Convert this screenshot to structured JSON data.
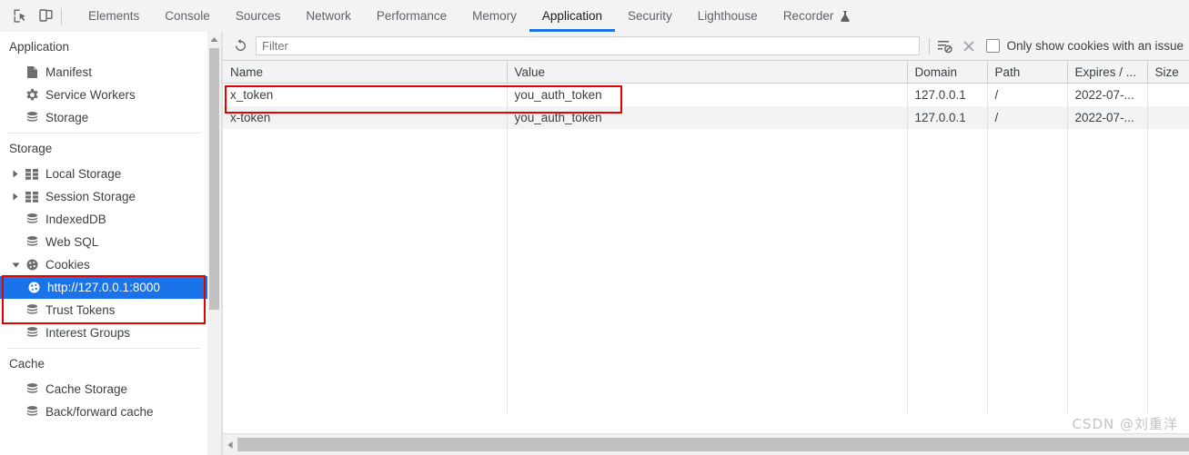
{
  "toolbar": {
    "inspect_icon": "inspect-element-icon",
    "device_icon": "device-toolbar-icon",
    "tabs": [
      {
        "label": "Elements",
        "active": false
      },
      {
        "label": "Console",
        "active": false
      },
      {
        "label": "Sources",
        "active": false
      },
      {
        "label": "Network",
        "active": false
      },
      {
        "label": "Performance",
        "active": false
      },
      {
        "label": "Memory",
        "active": false
      },
      {
        "label": "Application",
        "active": true
      },
      {
        "label": "Security",
        "active": false
      },
      {
        "label": "Lighthouse",
        "active": false
      },
      {
        "label": "Recorder",
        "active": false,
        "icon": "flask-experiment-icon"
      }
    ],
    "active_tab": "Application",
    "accent_color": "#1a73e8"
  },
  "sidebar": {
    "sections": [
      {
        "title": "Application",
        "items": [
          {
            "label": "Manifest",
            "icon": "document-icon",
            "expandable": false,
            "selected": false
          },
          {
            "label": "Service Workers",
            "icon": "gear-icon",
            "expandable": false,
            "selected": false
          },
          {
            "label": "Storage",
            "icon": "database-icon",
            "expandable": false,
            "selected": false
          }
        ]
      },
      {
        "title": "Storage",
        "items": [
          {
            "label": "Local Storage",
            "icon": "table-grid-icon",
            "expandable": true,
            "expanded": false,
            "selected": false
          },
          {
            "label": "Session Storage",
            "icon": "table-grid-icon",
            "expandable": true,
            "expanded": false,
            "selected": false
          },
          {
            "label": "IndexedDB",
            "icon": "database-icon",
            "expandable": false,
            "selected": false
          },
          {
            "label": "Web SQL",
            "icon": "database-icon",
            "expandable": false,
            "selected": false
          },
          {
            "label": "Cookies",
            "icon": "cookie-icon",
            "expandable": true,
            "expanded": true,
            "selected": false
          },
          {
            "label": "http://127.0.0.1:8000",
            "icon": "cookie-icon",
            "expandable": false,
            "selected": true,
            "child": true
          },
          {
            "label": "Trust Tokens",
            "icon": "database-icon",
            "expandable": false,
            "selected": false
          },
          {
            "label": "Interest Groups",
            "icon": "database-icon",
            "expandable": false,
            "selected": false
          }
        ]
      },
      {
        "title": "Cache",
        "items": [
          {
            "label": "Cache Storage",
            "icon": "database-icon",
            "expandable": false,
            "selected": false
          },
          {
            "label": "Back/forward cache",
            "icon": "database-icon",
            "expandable": false,
            "selected": false
          }
        ]
      }
    ]
  },
  "panel": {
    "refresh_icon": "refresh-icon",
    "clear_all_icon": "clear-all-cookies-icon",
    "delete_icon": "delete-selected-icon",
    "filter_placeholder": "Filter",
    "filter_value": "",
    "issue_checkbox_label": "Only show cookies with an issue",
    "issue_checkbox_checked": false
  },
  "table": {
    "columns": [
      "Name",
      "Value",
      "Domain",
      "Path",
      "Expires / ...",
      "Size"
    ],
    "rows": [
      {
        "name": "x_token",
        "value": "you_auth_token",
        "domain": "127.0.0.1",
        "path": "/",
        "expires": "2022-07-...",
        "size": "",
        "highlighted": true
      },
      {
        "name": "x-token",
        "value": "you_auth_token",
        "domain": "127.0.0.1",
        "path": "/",
        "expires": "2022-07-...",
        "size": "",
        "highlighted": false
      }
    ]
  },
  "annotations": {
    "highlight_color": "#e60000",
    "boxes": [
      {
        "name": "cookies-tree-highlight"
      },
      {
        "name": "first-cookie-row-highlight"
      }
    ]
  },
  "watermark": {
    "text": "CSDN @刘重洋"
  }
}
